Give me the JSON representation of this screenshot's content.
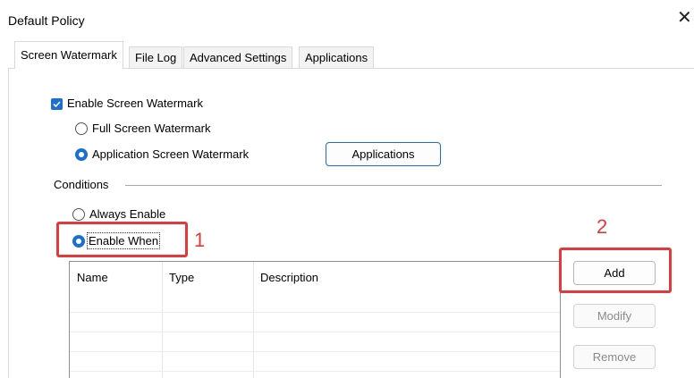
{
  "window": {
    "title": "Default Policy",
    "close_glyph": "✕"
  },
  "tabs": [
    {
      "label": "Screen Watermark",
      "active": true
    },
    {
      "label": "File Log",
      "active": false
    },
    {
      "label": "Advanced Settings",
      "active": false
    },
    {
      "label": "Applications",
      "active": false
    }
  ],
  "watermark": {
    "enable_label": "Enable Screen Watermark",
    "enable_checked": true,
    "full_screen_label": "Full Screen Watermark",
    "full_screen_selected": false,
    "app_screen_label": "Application Screen Watermark",
    "app_screen_selected": true,
    "applications_button": "Applications"
  },
  "conditions": {
    "group_label": "Conditions",
    "always_enable_label": "Always Enable",
    "always_enable_selected": false,
    "enable_when_label": "Enable When",
    "enable_when_selected": true
  },
  "table": {
    "columns": [
      "Name",
      "Type",
      "Description"
    ],
    "rows": []
  },
  "actions": {
    "add": "Add",
    "modify": "Modify",
    "remove": "Remove"
  },
  "annotations": {
    "marker_1": "1",
    "marker_2": "2",
    "color": "#e23a3a"
  },
  "colors": {
    "accent": "#1a6fd1"
  }
}
